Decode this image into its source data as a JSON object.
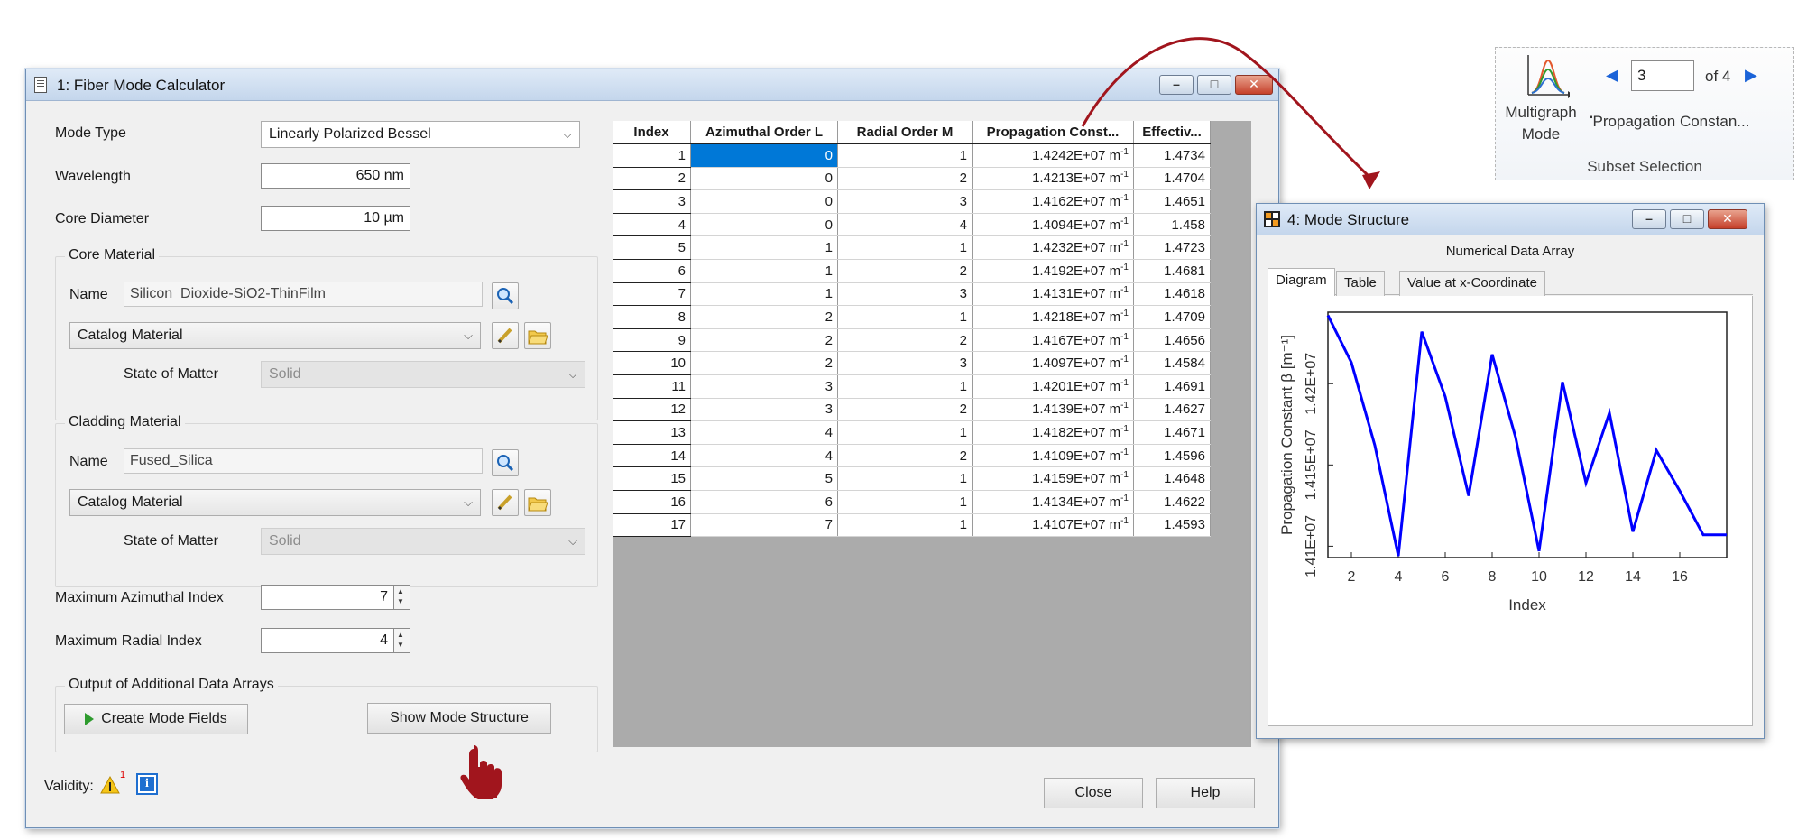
{
  "dialog": {
    "title": "1: Fiber Mode Calculator",
    "mode_type_label": "Mode Type",
    "mode_type_value": "Linearly Polarized Bessel",
    "wavelength_label": "Wavelength",
    "wavelength_value": "650 nm",
    "core_diameter_label": "Core Diameter",
    "core_diameter_value": "10 µm",
    "core_material": {
      "group_title": "Core Material",
      "name_label": "Name",
      "name_value": "Silicon_Dioxide-SiO2-ThinFilm",
      "catalog_value": "Catalog Material",
      "state_label": "State of Matter",
      "state_value": "Solid"
    },
    "cladding_material": {
      "group_title": "Cladding Material",
      "name_label": "Name",
      "name_value": "Fused_Silica",
      "catalog_value": "Catalog Material",
      "state_label": "State of Matter",
      "state_value": "Solid"
    },
    "max_azimuthal_label": "Maximum Azimuthal Index",
    "max_azimuthal_value": "7",
    "max_radial_label": "Maximum Radial Index",
    "max_radial_value": "4",
    "output_group_title": "Output of Additional Data Arrays",
    "create_mode_fields_label": "Create Mode Fields",
    "show_mode_structure_label": "Show Mode Structure",
    "validity_label": "Validity:",
    "validity_count": "1",
    "close_label": "Close",
    "help_label": "Help",
    "table": {
      "headers": [
        "Index",
        "Azimuthal Order L",
        "Radial Order M",
        "Propagation Const...",
        "Effectiv..."
      ],
      "unit": "m",
      "unit_exp": "-1",
      "rows": [
        [
          "1",
          "0",
          "1",
          "1.4242E+07",
          "1.4734"
        ],
        [
          "2",
          "0",
          "2",
          "1.4213E+07",
          "1.4704"
        ],
        [
          "3",
          "0",
          "3",
          "1.4162E+07",
          "1.4651"
        ],
        [
          "4",
          "0",
          "4",
          "1.4094E+07",
          "1.458"
        ],
        [
          "5",
          "1",
          "1",
          "1.4232E+07",
          "1.4723"
        ],
        [
          "6",
          "1",
          "2",
          "1.4192E+07",
          "1.4681"
        ],
        [
          "7",
          "1",
          "3",
          "1.4131E+07",
          "1.4618"
        ],
        [
          "8",
          "2",
          "1",
          "1.4218E+07",
          "1.4709"
        ],
        [
          "9",
          "2",
          "2",
          "1.4167E+07",
          "1.4656"
        ],
        [
          "10",
          "2",
          "3",
          "1.4097E+07",
          "1.4584"
        ],
        [
          "11",
          "3",
          "1",
          "1.4201E+07",
          "1.4691"
        ],
        [
          "12",
          "3",
          "2",
          "1.4139E+07",
          "1.4627"
        ],
        [
          "13",
          "4",
          "1",
          "1.4182E+07",
          "1.4671"
        ],
        [
          "14",
          "4",
          "2",
          "1.4109E+07",
          "1.4596"
        ],
        [
          "15",
          "5",
          "1",
          "1.4159E+07",
          "1.4648"
        ],
        [
          "16",
          "6",
          "1",
          "1.4134E+07",
          "1.4622"
        ],
        [
          "17",
          "7",
          "1",
          "1.4107E+07",
          "1.4593"
        ]
      ]
    }
  },
  "mode_structure": {
    "title": "4: Mode Structure",
    "subtitle": "Numerical Data Array",
    "tabs": [
      "Diagram",
      "Table",
      "Value at x-Coordinate"
    ],
    "chart_data": {
      "type": "line",
      "xlabel": "Index",
      "ylabel": "Propagation Constant β [m⁻¹]",
      "x": [
        1,
        2,
        3,
        4,
        5,
        6,
        7,
        8,
        9,
        10,
        11,
        12,
        13,
        14,
        15,
        16,
        17
      ],
      "series": [
        {
          "values": [
            14242000,
            14213000,
            14162000,
            14094000,
            14232000,
            14192000,
            14131000,
            14218000,
            14167000,
            14097000,
            14201000,
            14139000,
            14182000,
            14109000,
            14159000,
            14134000,
            14107000
          ]
        }
      ],
      "xlim": [
        1,
        18
      ],
      "ylim": [
        14093000,
        14244000
      ],
      "x_ticks": [
        2,
        4,
        6,
        8,
        10,
        12,
        14,
        16
      ],
      "y_ticks": [
        14100000,
        14150000,
        14200000
      ],
      "y_tick_labels": [
        "1.41E+07",
        "1.415E+07",
        "1.42E+07"
      ],
      "line_color": "#0000ff",
      "grid": false
    }
  },
  "ribbon": {
    "multigraph_label_1": "Multigraph",
    "multigraph_label_2": "Mode",
    "subset_value": "3",
    "of_label": "of 4",
    "propagation_label": "Propagation Constan...",
    "section_label": "Subset Selection"
  },
  "colors": {
    "accent": "#0078d7",
    "arrow": "#a1151d",
    "title_bar": "#c4d6ec"
  }
}
